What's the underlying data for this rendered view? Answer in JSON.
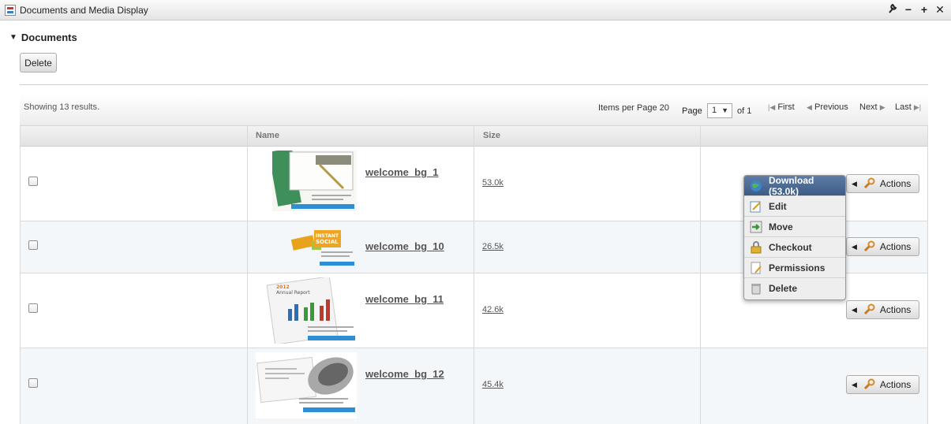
{
  "portlet": {
    "title": "Documents and Media Display",
    "controls": [
      "wrench-icon",
      "minimize-icon",
      "maximize-icon",
      "close-icon"
    ]
  },
  "section": {
    "title": "Documents"
  },
  "toolbar": {
    "delete_label": "Delete"
  },
  "results": {
    "showing": "Showing 13 results.",
    "items_per_page": "Items per Page 20",
    "page_label": "Page",
    "page_value": "1",
    "of_label": "of 1",
    "first": "First",
    "previous": "Previous",
    "next": "Next",
    "last": "Last"
  },
  "columns": {
    "name": "Name",
    "size": "Size"
  },
  "rows": [
    {
      "name": "welcome_bg_1",
      "size": "53.0k",
      "actions": "Actions"
    },
    {
      "name": "welcome_bg_10",
      "size": "26.5k",
      "actions": "Actions"
    },
    {
      "name": "welcome_bg_11",
      "size": "42.6k",
      "actions": "Actions"
    },
    {
      "name": "welcome_bg_12",
      "size": "45.4k",
      "actions": "Actions"
    }
  ],
  "menu": {
    "items": [
      "Download (53.0k)",
      "Edit",
      "Move",
      "Checkout",
      "Permissions",
      "Delete"
    ],
    "icons": [
      "globe-download-icon",
      "edit-icon",
      "move-icon",
      "lock-icon",
      "permissions-icon",
      "trash-icon"
    ]
  },
  "colors": {
    "menu_selected": "#4a6a95",
    "link": "#555555",
    "row_alt": "#f4f7fa"
  }
}
